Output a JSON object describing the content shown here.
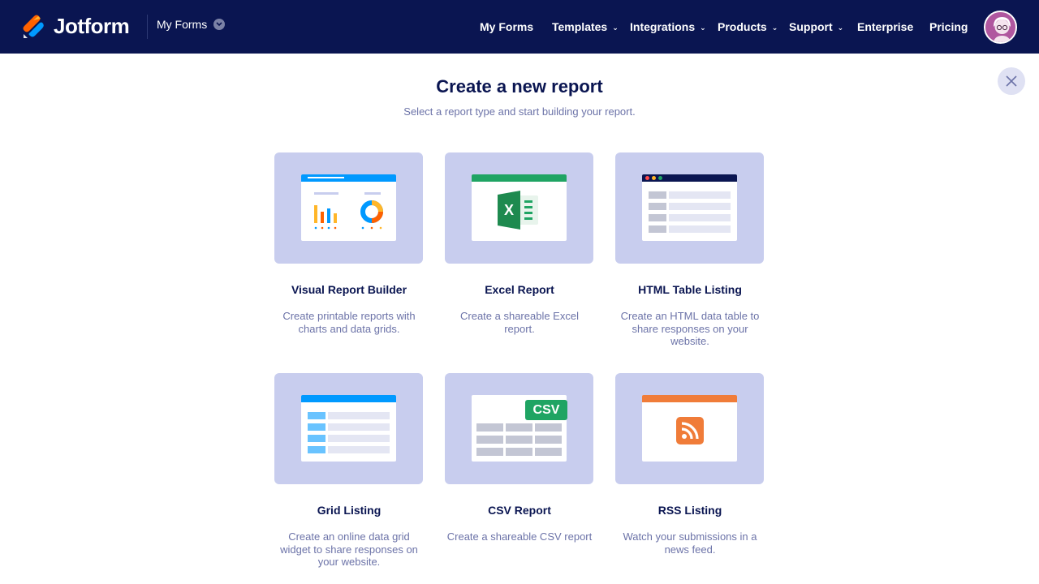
{
  "header": {
    "brand": "Jotform",
    "myforms_dropdown_label": "My Forms",
    "nav": [
      {
        "label": "My Forms",
        "has_dropdown": false
      },
      {
        "label": "Templates",
        "has_dropdown": true
      },
      {
        "label": "Integrations",
        "has_dropdown": true
      },
      {
        "label": "Products",
        "has_dropdown": true
      },
      {
        "label": "Support",
        "has_dropdown": true
      },
      {
        "label": "Enterprise",
        "has_dropdown": false
      },
      {
        "label": "Pricing",
        "has_dropdown": false
      }
    ],
    "background_color": "#0a1551"
  },
  "main": {
    "title": "Create a new report",
    "subtitle": "Select a report type and start building your report.",
    "close_icon": "close-icon",
    "cards": [
      {
        "name": "Visual Report Builder",
        "description": "Create printable reports with charts and data grids.",
        "icon": "visual-report-icon"
      },
      {
        "name": "Excel Report",
        "description": "Create a shareable Excel report.",
        "icon": "excel-icon"
      },
      {
        "name": "HTML Table Listing",
        "description": "Create an HTML data table to share responses on your website.",
        "icon": "html-table-icon"
      },
      {
        "name": "Grid Listing",
        "description": "Create an online data grid widget to share responses on your website.",
        "icon": "grid-listing-icon"
      },
      {
        "name": "CSV Report",
        "description": "Create a shareable CSV report",
        "icon": "csv-icon",
        "badge": "CSV"
      },
      {
        "name": "RSS Listing",
        "description": "Watch your submissions in a news feed.",
        "icon": "rss-icon"
      }
    ],
    "card_background": "#c8cdee"
  }
}
